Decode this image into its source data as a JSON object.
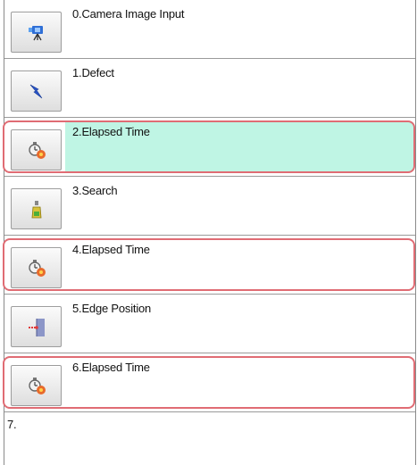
{
  "items": [
    {
      "label": "0.Camera Image Input",
      "icon": "camera-icon"
    },
    {
      "label": "1.Defect",
      "icon": "defect-lightning-icon"
    },
    {
      "label": "2.Elapsed Time",
      "icon": "stopwatch-icon",
      "selected": true,
      "highlighted": true
    },
    {
      "label": "3.Search",
      "icon": "search-bottle-icon"
    },
    {
      "label": "4.Elapsed Time",
      "icon": "stopwatch-icon",
      "highlighted": true
    },
    {
      "label": "5.Edge Position",
      "icon": "edge-position-icon"
    },
    {
      "label": "6.Elapsed Time",
      "icon": "stopwatch-icon",
      "highlighted": true
    },
    {
      "label": "7."
    }
  ],
  "colors": {
    "highlight_border": "#e06c74",
    "selected_background": "#bff5e4",
    "row_divider": "#9a9a9a"
  }
}
